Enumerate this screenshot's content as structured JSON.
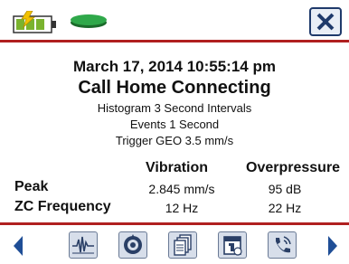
{
  "header": {
    "battery_icon": "battery-charging-icon",
    "status_icon": "status-disc-icon",
    "close_icon": "close-icon",
    "accent_color": "#b02020",
    "button_border_color": "#1f3a6b"
  },
  "main": {
    "datetime": "March 17, 2014 10:55:14 pm",
    "status": "Call Home Connecting",
    "histogram": "Histogram 3 Second Intervals",
    "events": "Events 1 Second",
    "trigger": "Trigger GEO 3.5 mm/s"
  },
  "measurements": {
    "columns": [
      "Vibration",
      "Overpressure"
    ],
    "rows": [
      {
        "label": "Peak",
        "vibration": "2.845 mm/s",
        "overpressure": "95 dB"
      },
      {
        "label": "ZC Frequency",
        "vibration": "12 Hz",
        "overpressure": "22 Hz"
      }
    ]
  },
  "footer": {
    "icons": [
      "waveform-icon",
      "seal-icon",
      "documents-icon",
      "calendar-icon",
      "phone-call-icon"
    ],
    "prev_icon": "arrow-left-icon",
    "next_icon": "arrow-right-icon"
  }
}
